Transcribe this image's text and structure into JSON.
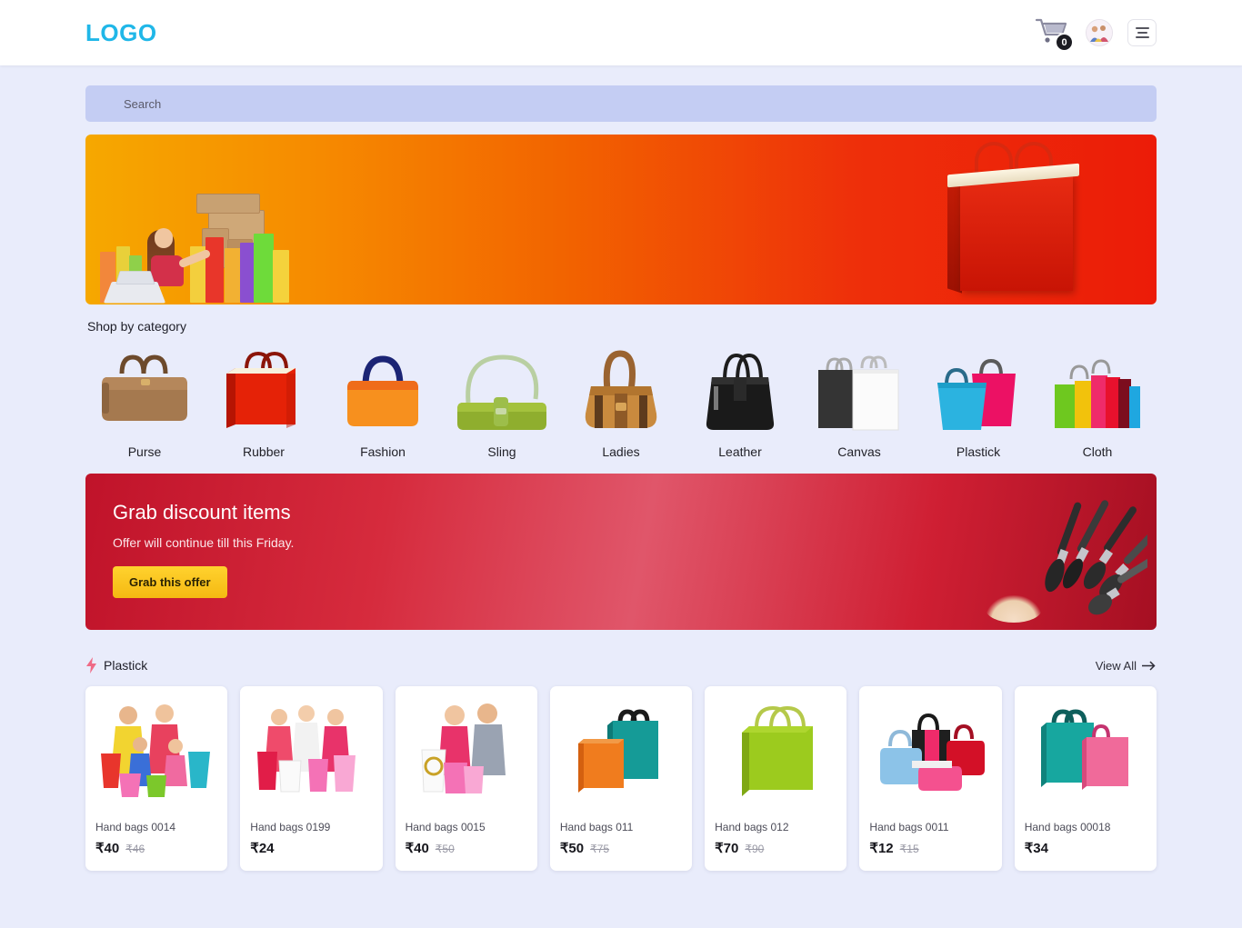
{
  "header": {
    "logo": "LOGO",
    "cart_icon": "shopping-cart-icon",
    "cart_count": "0",
    "avatar_icon": "user-avatar",
    "menu_icon": "hamburger-menu-icon"
  },
  "search": {
    "placeholder": "Search",
    "value": ""
  },
  "hero": {
    "alt_left": "woman-shopping-bags-image",
    "alt_right": "red-shopping-bag-image"
  },
  "categories": {
    "title": "Shop by category",
    "items": [
      {
        "label": "Purse",
        "icon": "brown-handbag-icon"
      },
      {
        "label": "Rubber",
        "icon": "red-shopping-bag-icon"
      },
      {
        "label": "Fashion",
        "icon": "orange-tote-bag-icon"
      },
      {
        "label": "Sling",
        "icon": "green-sling-bag-icon"
      },
      {
        "label": "Ladies",
        "icon": "tan-ladies-bag-icon"
      },
      {
        "label": "Leather",
        "icon": "black-leather-tote-icon"
      },
      {
        "label": "Canvas",
        "icon": "black-white-paper-bags-icon"
      },
      {
        "label": "Plastick",
        "icon": "blue-pink-plastic-bags-icon"
      },
      {
        "label": "Cloth",
        "icon": "multicolor-cloth-bags-icon"
      }
    ]
  },
  "promo": {
    "title": "Grab discount items",
    "subtitle": "Offer will continue till this Friday.",
    "button": "Grab this offer",
    "image_alt": "makeup-brushes-image"
  },
  "products_section": {
    "icon": "lightning-bolt-icon",
    "title": "Plastick",
    "view_all": "View All",
    "view_all_icon": "arrow-right-icon",
    "items": [
      {
        "title": "Hand bags 0014",
        "price": "₹40",
        "old_price": "₹46",
        "image": "family-with-shopping-bags-image"
      },
      {
        "title": "Hand bags 0199",
        "price": "₹24",
        "old_price": "",
        "image": "women-shopping-image"
      },
      {
        "title": "Hand bags 0015",
        "price": "₹40",
        "old_price": "₹50",
        "image": "couple-shopping-image"
      },
      {
        "title": "Hand bags 011",
        "price": "₹50",
        "old_price": "₹75",
        "image": "orange-teal-bags-image"
      },
      {
        "title": "Hand bags 012",
        "price": "₹70",
        "old_price": "₹90",
        "image": "green-tote-bag-image"
      },
      {
        "title": "Hand bags 0011",
        "price": "₹12",
        "old_price": "₹15",
        "image": "assorted-handbags-image"
      },
      {
        "title": "Hand bags 00018",
        "price": "₹34",
        "old_price": "",
        "image": "teal-pink-bags-image"
      }
    ]
  },
  "colors": {
    "brand": "#20b7e8",
    "page_bg": "#e9ecfb",
    "search_bg": "#c4cdf3",
    "hero_from": "#f6a800",
    "hero_to": "#ec1c08",
    "promo_from": "#c0132a",
    "promo_to": "#a50f22",
    "promo_button": "#ffd22e",
    "badge_bg": "#1c1c22"
  }
}
